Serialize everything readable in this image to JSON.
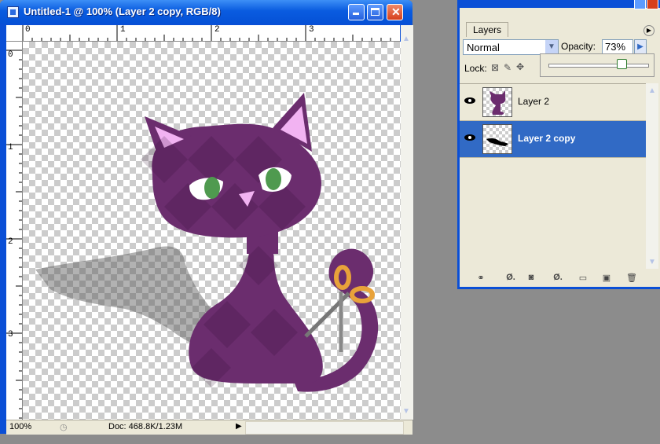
{
  "document": {
    "title": "Untitled-1 @ 100% (Layer 2 copy, RGB/8)",
    "ruler_top_numbers": [
      "0",
      "1",
      "2",
      "3"
    ],
    "ruler_left_numbers": [
      "0",
      "1",
      "2",
      "3"
    ],
    "zoom": "100%",
    "doc_info": "Doc: 468.8K/1.23M"
  },
  "layers_panel": {
    "tab": "Layers",
    "blend_mode": "Normal",
    "opacity_label": "Opacity:",
    "opacity_value": "73%",
    "opacity_fraction": 0.73,
    "lock_label": "Lock:",
    "layers": [
      {
        "name": "Layer 2",
        "selected": false
      },
      {
        "name": "Layer 2 copy",
        "selected": true
      }
    ]
  },
  "colors": {
    "cat_purple": "#6b2d6e",
    "ear_pink": "#f2b3f2",
    "eye_green": "#4f9a4f",
    "selection_blue": "#316ac5",
    "scissors_orange": "#e8a23a"
  },
  "icons": [
    "document-icon",
    "minimize-icon",
    "maximize-icon",
    "close-icon",
    "eye-icon",
    "chevron-down-icon",
    "play-icon",
    "link-icon",
    "fx-icon",
    "mask-icon",
    "adjustment-icon",
    "folder-icon",
    "new-layer-icon",
    "trash-icon"
  ]
}
